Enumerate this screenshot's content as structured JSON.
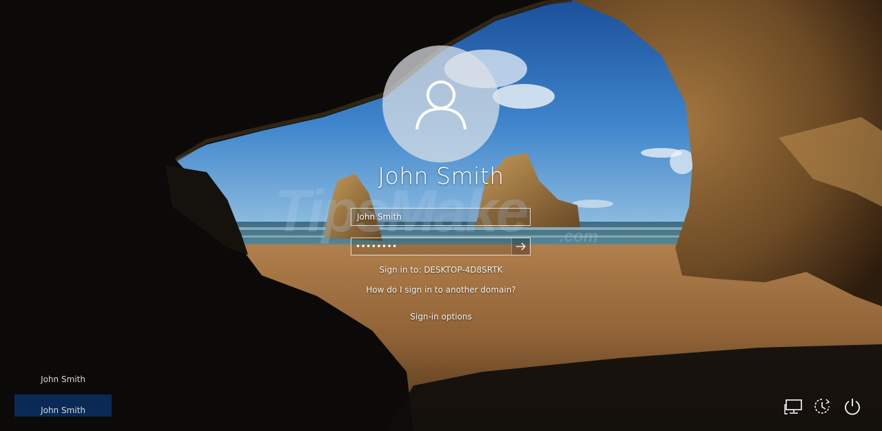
{
  "watermark": {
    "brand": "TipsMake",
    "suffix": ".com"
  },
  "login": {
    "user_name": "John Smith",
    "username_value": "John Smith",
    "password_masked": "••••••••",
    "sign_in_to": "Sign in to: DESKTOP-4D8SRTK",
    "other_domain_link": "How do I sign in to another domain?",
    "sign_in_options": "Sign-in options"
  },
  "user_list": [
    {
      "name": "John Smith",
      "selected": false
    },
    {
      "name": "John Smith",
      "selected": true
    }
  ],
  "system_icons": [
    "network-icon",
    "ease-of-access-icon",
    "power-icon"
  ],
  "colors": {
    "selected_user_bg": "#0a2a55",
    "field_border": "#ffffff"
  }
}
